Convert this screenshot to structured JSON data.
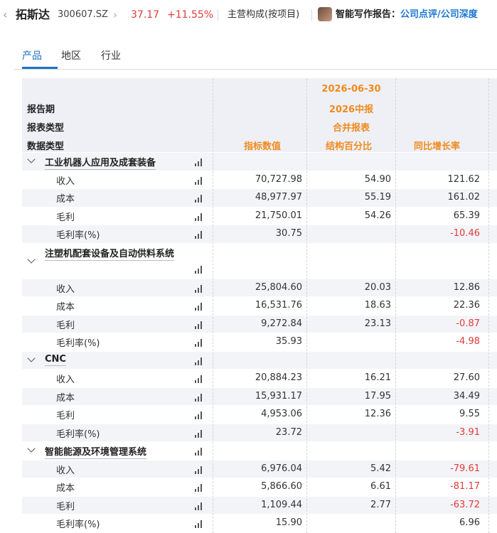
{
  "header": {
    "back_icon": "chevron-left-icon",
    "stock_name": "拓斯达",
    "stock_code": "300607.SZ",
    "nav_icon": "chevron-right-icon",
    "price": "37.17",
    "change_pct": "+11.55%",
    "page_label": "主营构成(按项目)",
    "ai_label": "智能写作报告：",
    "ai_links": [
      "公司点评",
      "/",
      "公司深度"
    ]
  },
  "tabs": [
    {
      "label": "产品",
      "active": true
    },
    {
      "label": "地区",
      "active": false
    },
    {
      "label": "行业",
      "active": false
    }
  ],
  "table": {
    "header_labels": [
      "报告期",
      "报表类型",
      "数据类型"
    ],
    "period": "2026-06-30",
    "report_name": "2026中报",
    "report_type": "合并报表",
    "columns": [
      "指标数值",
      "结构百分比",
      "同比增长率"
    ],
    "accent_color": "#f08a1e",
    "negative_color": "#e23b3b",
    "sections": [
      {
        "name": "工业机器人应用及成套装备",
        "rows": [
          {
            "label": "收入",
            "value": "70,727.98",
            "pct": "54.90",
            "yoy": "121.62"
          },
          {
            "label": "成本",
            "value": "48,977.97",
            "pct": "55.19",
            "yoy": "161.02"
          },
          {
            "label": "毛利",
            "value": "21,750.01",
            "pct": "54.26",
            "yoy": "65.39"
          },
          {
            "label": "毛利率(%)",
            "value": "30.75",
            "pct": "",
            "yoy": "-10.46"
          }
        ]
      },
      {
        "name": "注塑机配套设备及自动供料系统",
        "rows": [
          {
            "label": "收入",
            "value": "25,804.60",
            "pct": "20.03",
            "yoy": "12.86"
          },
          {
            "label": "成本",
            "value": "16,531.76",
            "pct": "18.63",
            "yoy": "22.36"
          },
          {
            "label": "毛利",
            "value": "9,272.84",
            "pct": "23.13",
            "yoy": "-0.87"
          },
          {
            "label": "毛利率(%)",
            "value": "35.93",
            "pct": "",
            "yoy": "-4.98"
          }
        ]
      },
      {
        "name": "CNC",
        "rows": [
          {
            "label": "收入",
            "value": "20,884.23",
            "pct": "16.21",
            "yoy": "27.60"
          },
          {
            "label": "成本",
            "value": "15,931.17",
            "pct": "17.95",
            "yoy": "34.49"
          },
          {
            "label": "毛利",
            "value": "4,953.06",
            "pct": "12.36",
            "yoy": "9.55"
          },
          {
            "label": "毛利率(%)",
            "value": "23.72",
            "pct": "",
            "yoy": "-3.91"
          }
        ]
      },
      {
        "name": "智能能源及环境管理系统",
        "rows": [
          {
            "label": "收入",
            "value": "6,976.04",
            "pct": "5.42",
            "yoy": "-79.61"
          },
          {
            "label": "成本",
            "value": "5,866.60",
            "pct": "6.61",
            "yoy": "-81.17"
          },
          {
            "label": "毛利",
            "value": "1,109.44",
            "pct": "2.77",
            "yoy": "-63.72"
          },
          {
            "label": "毛利率(%)",
            "value": "15.90",
            "pct": "",
            "yoy": "6.96"
          }
        ]
      }
    ]
  }
}
